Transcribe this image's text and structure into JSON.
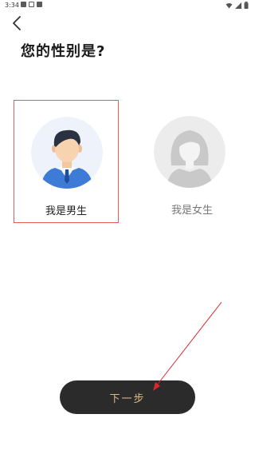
{
  "status_bar": {
    "time": "3:34",
    "left_icons": [
      "image-icon",
      "sim-icon",
      "sd-card-icon"
    ],
    "right_icons": [
      "wifi-icon",
      "signal-icon",
      "battery-icon"
    ]
  },
  "header": {
    "back_icon": "chevron-left-icon",
    "title": "您的性别是?"
  },
  "options": [
    {
      "label": "我是男生",
      "avatar": "male-avatar-icon",
      "selected": true
    },
    {
      "label": "我是女生",
      "avatar": "female-avatar-icon",
      "selected": false
    }
  ],
  "next_button": {
    "label": "下一步"
  },
  "colors": {
    "selection_border": "#e85a5a",
    "button_bg": "#2b2b2b",
    "button_text": "#d8b98a",
    "annotation_arrow": "#d9282f"
  }
}
